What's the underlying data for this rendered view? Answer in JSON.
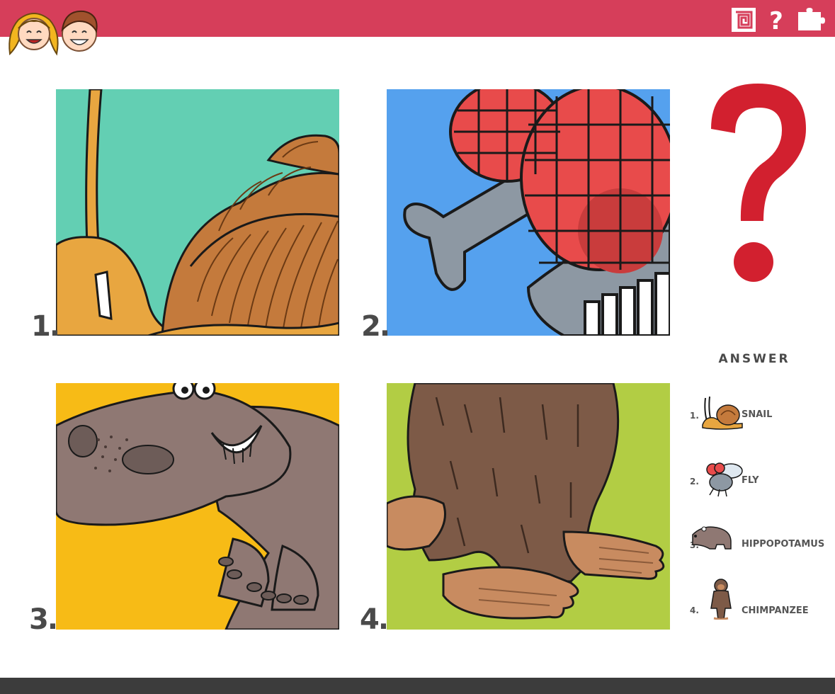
{
  "colors": {
    "header": "#d63e5a",
    "footer": "#3c3c3c",
    "question_mark": "#d2202f",
    "number_text": "#4a4a4a"
  },
  "header": {
    "icons": [
      "kids-faces-icon",
      "spiral-square-icon",
      "question-icon",
      "puzzle-piece-icon"
    ],
    "help_glyph": "?"
  },
  "panels": [
    {
      "number": "1.",
      "background": "#63cfb3",
      "icon": "snail-closeup"
    },
    {
      "number": "2.",
      "background": "#55a1ee",
      "icon": "fly-closeup"
    },
    {
      "number": "3.",
      "background": "#f7bb16",
      "icon": "hippopotamus-closeup"
    },
    {
      "number": "4.",
      "background": "#b2cd44",
      "icon": "chimpanzee-closeup"
    }
  ],
  "question_mark": "?",
  "answer": {
    "title": "ANSWER",
    "items": [
      {
        "number": "1.",
        "label": "SNAIL",
        "icon": "snail-icon"
      },
      {
        "number": "2.",
        "label": "FLY",
        "icon": "fly-icon"
      },
      {
        "number": "3.",
        "label": "HIPPOPOTAMUS",
        "icon": "hippopotamus-icon"
      },
      {
        "number": "4.",
        "label": "CHIMPANZEE",
        "icon": "chimpanzee-icon"
      }
    ]
  }
}
